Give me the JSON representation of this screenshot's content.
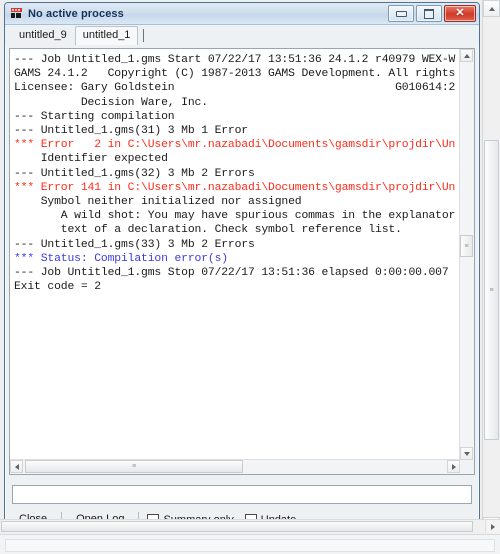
{
  "window": {
    "title": "No active process",
    "icon": "gams-process-icon",
    "controls": {
      "minimize_label": "Minimize",
      "maximize_label": "Maximize",
      "close_label": "✕"
    }
  },
  "tabs": [
    {
      "label": "untitled_9",
      "active": false
    },
    {
      "label": "untitled_1",
      "active": true
    }
  ],
  "log": {
    "lines": [
      {
        "text": "--- Job Untitled_1.gms Start 07/22/17 13:51:36 24.1.2 r40979 WEX-W",
        "style": "normal"
      },
      {
        "text": "GAMS 24.1.2   Copyright (C) 1987-2013 GAMS Development. All rights",
        "style": "normal"
      },
      {
        "text": "Licensee: Gary Goldstein                                 G010614:2",
        "style": "normal"
      },
      {
        "text": "          Decision Ware, Inc.",
        "style": "normal"
      },
      {
        "text": "--- Starting compilation",
        "style": "normal"
      },
      {
        "text": "--- Untitled_1.gms(31) 3 Mb 1 Error",
        "style": "normal"
      },
      {
        "text": "*** Error   2 in C:\\Users\\mr.nazabadi\\Documents\\gamsdir\\projdir\\Un",
        "style": "error"
      },
      {
        "text": "    Identifier expected",
        "style": "normal"
      },
      {
        "text": "--- Untitled_1.gms(32) 3 Mb 2 Errors",
        "style": "normal"
      },
      {
        "text": "*** Error 141 in C:\\Users\\mr.nazabadi\\Documents\\gamsdir\\projdir\\Un",
        "style": "error"
      },
      {
        "text": "    Symbol neither initialized nor assigned",
        "style": "normal"
      },
      {
        "text": "       A wild shot: You may have spurious commas in the explanator",
        "style": "normal"
      },
      {
        "text": "       text of a declaration. Check symbol reference list.",
        "style": "normal"
      },
      {
        "text": "--- Untitled_1.gms(33) 3 Mb 2 Errors",
        "style": "normal"
      },
      {
        "text": "*** Status: Compilation error(s)",
        "style": "status"
      },
      {
        "text": "--- Job Untitled_1.gms Stop 07/22/17 13:51:36 elapsed 0:00:00.007",
        "style": "normal"
      },
      {
        "text": "Exit code = 2",
        "style": "selected"
      }
    ]
  },
  "command_field": {
    "value": "",
    "placeholder": ""
  },
  "toolbar": {
    "close_label": "Close",
    "open_log_label": "Open Log",
    "summary_only_label": "Summary only",
    "summary_only_checked": false,
    "update_label": "Update",
    "update_checked": true
  },
  "colors": {
    "error_red": "#ff2b19",
    "status_blue": "#3b3bdd",
    "title_blue": "#15325a",
    "close_red": "#cf3a28"
  }
}
